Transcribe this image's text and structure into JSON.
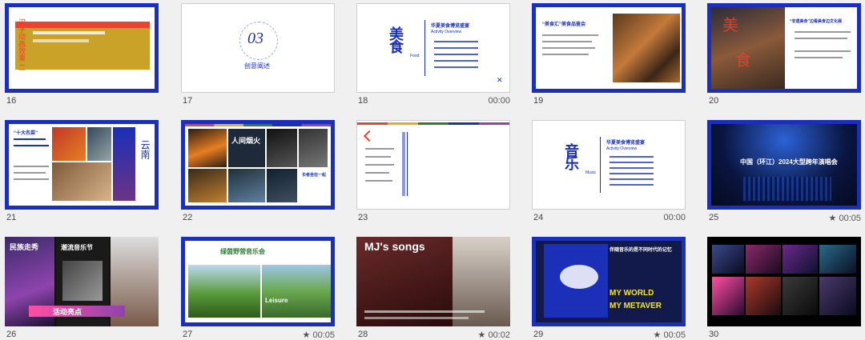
{
  "slides": [
    {
      "num": "16",
      "meta": "",
      "title": "",
      "vtitle": "汉字动画效果 二"
    },
    {
      "num": "17",
      "meta": "",
      "title": "创意阐述",
      "big": "03"
    },
    {
      "num": "18",
      "meta": "00:00",
      "title": "华夏美食博览盛宴",
      "subtitle": "Activity Overview",
      "big": "美食",
      "en": "Food"
    },
    {
      "num": "19",
      "meta": "",
      "title": "“美食汇”美食品鉴会"
    },
    {
      "num": "20",
      "meta": "",
      "title": "“非遗美食”边看美食边文化展"
    },
    {
      "num": "21",
      "meta": "",
      "title": "“十大名菜”",
      "side": "云南"
    },
    {
      "num": "22",
      "meta": "",
      "title": "人间烟火",
      "caption": "长者坐在一起"
    },
    {
      "num": "23",
      "meta": "",
      "title": ""
    },
    {
      "num": "24",
      "meta": "00:00",
      "title": "华夏美食博览盛宴",
      "subtitle": "Activity Overview",
      "big": "音乐",
      "en": "Music"
    },
    {
      "num": "25",
      "meta": "★ 00:05",
      "title": "中国（环江）2024大型跨年演唱会"
    },
    {
      "num": "26",
      "meta": "",
      "title": "潮流音乐节",
      "left": "民族走秀",
      "right": "活动亮点"
    },
    {
      "num": "27",
      "meta": "★ 00:05",
      "title": "绿茵野营音乐会",
      "tag": "Leisure"
    },
    {
      "num": "28",
      "meta": "★ 00:02",
      "title": "MJ's songs"
    },
    {
      "num": "29",
      "meta": "★ 00:05",
      "title": "伴随音乐的是不同时代的记忆",
      "line2": "MY WORLD",
      "line3": "MY METAVER"
    },
    {
      "num": "30",
      "meta": "",
      "title": ""
    }
  ],
  "colors": {
    "brand": "#1b2fb8",
    "accent": "#e8442e",
    "gold": "#f5a623"
  }
}
